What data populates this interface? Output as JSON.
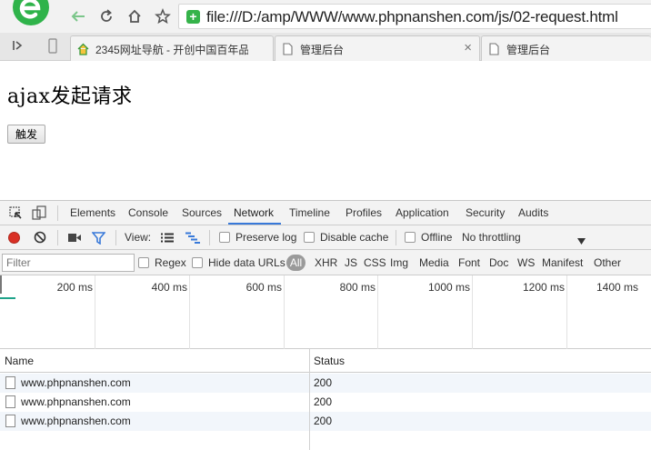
{
  "browser": {
    "address": "file:///D:/amp/WWW/www.phpnanshen.com/js/02-request.html",
    "tabs": [
      {
        "label": "2345网址导航 - 开创中国百年品",
        "close": "×"
      },
      {
        "label": "管理后台",
        "close": "×"
      },
      {
        "label": "管理后台",
        "close": ""
      }
    ],
    "colors": {
      "logo": "#2fb34a",
      "back_arrow": "#7bc68a",
      "shield": "#35b34a"
    }
  },
  "page": {
    "heading": "ajax发起请求",
    "button_label": "触发"
  },
  "devtools": {
    "tabs": [
      "Elements",
      "Console",
      "Sources",
      "Network",
      "Timeline",
      "Profiles",
      "Application",
      "Security",
      "Audits"
    ],
    "active_tab": "Network",
    "controls": {
      "view_label": "View:",
      "preserve_log": "Preserve log",
      "disable_cache": "Disable cache",
      "offline": "Offline",
      "throttling": "No throttling"
    },
    "filter": {
      "placeholder": "Filter",
      "regex": "Regex",
      "hide_data_urls": "Hide data URLs",
      "types": [
        "All",
        "XHR",
        "JS",
        "CSS",
        "Img",
        "Media",
        "Font",
        "Doc",
        "WS",
        "Manifest",
        "Other"
      ]
    },
    "timeline_ticks": [
      "200 ms",
      "400 ms",
      "600 ms",
      "800 ms",
      "1000 ms",
      "1200 ms",
      "1400 ms"
    ],
    "table": {
      "columns": [
        "Name",
        "Status"
      ],
      "rows": [
        {
          "name": "www.phpnanshen.com",
          "status": "200"
        },
        {
          "name": "www.phpnanshen.com",
          "status": "200"
        },
        {
          "name": "www.phpnanshen.com",
          "status": "200"
        }
      ]
    },
    "colors": {
      "record": "#d93025",
      "active_underline": "#3879d9",
      "filter_icon": "#3879d9",
      "timeline_bar": "#1fa38a"
    }
  }
}
